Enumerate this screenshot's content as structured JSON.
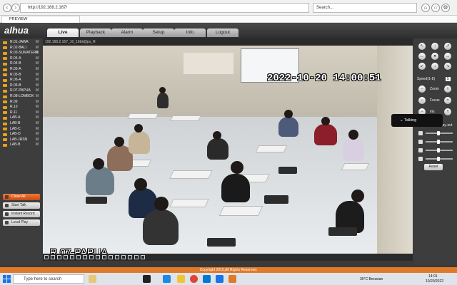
{
  "browser": {
    "url": "http://192.168.2.167/",
    "search_placeholder": "Search...",
    "tab_title": "PREVIEW"
  },
  "app": {
    "logo": "alhua",
    "menu": [
      "Live",
      "Playback",
      "Alarm",
      "Setup",
      "Info",
      "Logout"
    ],
    "active_menu": "Live",
    "video_header": "192.168.2.167_10_16bit@ps_R",
    "channels": [
      {
        "label": "R.01-JAWA",
        "mark": "M"
      },
      {
        "label": "R.02-BALI",
        "mark": "M"
      },
      {
        "label": "R.03-SUMATERA",
        "mark": "M"
      },
      {
        "label": "R.04-A",
        "mark": "M"
      },
      {
        "label": "R.04-B",
        "mark": "M"
      },
      {
        "label": "R.05-A",
        "mark": "M"
      },
      {
        "label": "R.05-B",
        "mark": "M"
      },
      {
        "label": "R.06-A",
        "mark": "M"
      },
      {
        "label": "R.06-B",
        "mark": "M"
      },
      {
        "label": "R.07-PAPUA",
        "mark": "M"
      },
      {
        "label": "R.08-LOMBOK",
        "mark": "M"
      },
      {
        "label": "R.09",
        "mark": "M"
      },
      {
        "label": "R.10",
        "mark": "M"
      },
      {
        "label": "R.11",
        "mark": "M"
      },
      {
        "label": "LAB-A",
        "mark": "M"
      },
      {
        "label": "LAB-B",
        "mark": "M"
      },
      {
        "label": "LAB-C",
        "mark": "M"
      },
      {
        "label": "LAB-D",
        "mark": "M"
      },
      {
        "label": "LAB-JRSN",
        "mark": "M"
      },
      {
        "label": "LAB-B",
        "mark": "M"
      }
    ],
    "buttons": {
      "close_all": "Close All",
      "start_talk": "Start Talk",
      "instant_record": "Instant Record",
      "local_play": "Local Play"
    },
    "osd_time": "2022-10-20 14:00:51",
    "osd_name": "R.07-PAPUA",
    "talking_popup": "Talking",
    "right_panel": {
      "speed_label": "Speed(1-8)",
      "speed_value": "5",
      "zoom_label": "Zoom",
      "focus_label": "Focus",
      "iris_label": "Iris",
      "image_setup_label": "Image Setup",
      "relay_out_label": "Relay-out",
      "reset_label": "Reset"
    },
    "copyright": "Copyright 2015,All Rights Reserved."
  },
  "taskbar": {
    "search_placeholder": "Type here to search",
    "weather": "30°C  Berawan",
    "time": "14:01",
    "date": "10/20/2022"
  },
  "colors": {
    "accent": "#e07a2a",
    "channel_icon": "#e7a21b",
    "app_bg": "#3a3a3a"
  }
}
